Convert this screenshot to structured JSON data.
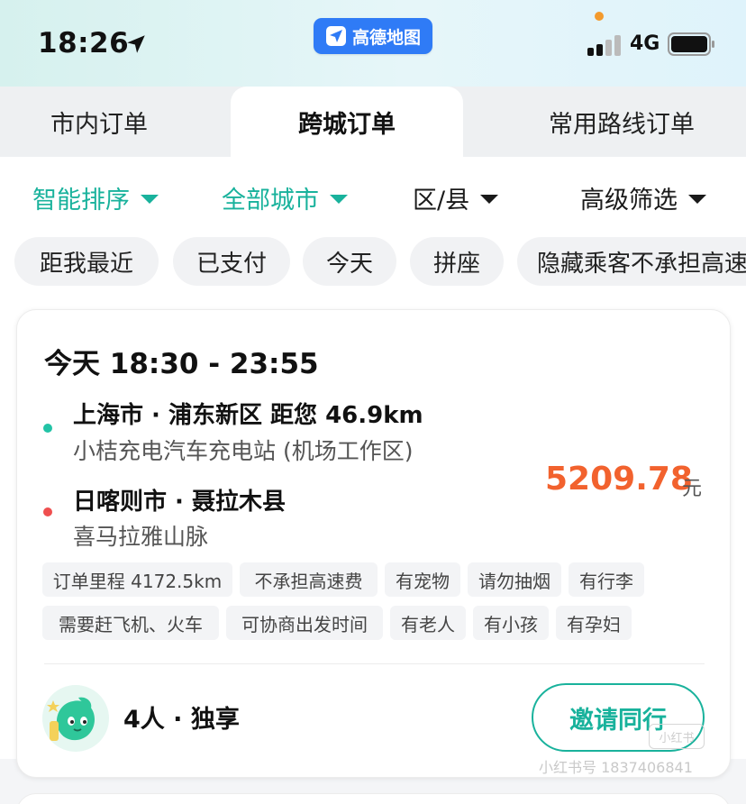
{
  "status_bar": {
    "time": "18:26",
    "app_name": "高德地图",
    "network": "4G"
  },
  "tabs": [
    {
      "label": "市内订单",
      "active": false
    },
    {
      "label": "跨城订单",
      "active": true
    },
    {
      "label": "常用路线订单",
      "active": false
    }
  ],
  "filters": [
    {
      "label": "智能排序",
      "style": "green"
    },
    {
      "label": "全部城市",
      "style": "green"
    },
    {
      "label": "区/县",
      "style": "dark"
    },
    {
      "label": "高级筛选",
      "style": "dark"
    }
  ],
  "chips": [
    "距我最近",
    "已支付",
    "今天",
    "拼座",
    "隐藏乘客不承担高速"
  ],
  "order": {
    "time_range": "今天 18:30 - 23:55",
    "start": {
      "title": "上海市 · 浦东新区 距您 46.9km",
      "detail": "小桔充电汽车充电站 (机场工作区)"
    },
    "end": {
      "title": "日喀则市 · 聂拉木县",
      "detail": "喜马拉雅山脉"
    },
    "price": "5209.78",
    "price_unit": "元",
    "tags_row1": [
      "订单里程 4172.5km",
      "不承担高速费",
      "有宠物",
      "请勿抽烟",
      "有行李"
    ],
    "tags_row2": [
      "需要赶飞机、火车",
      "可协商出发时间",
      "有老人",
      "有小孩",
      "有孕妇"
    ],
    "seats": "4人 · 独享",
    "invite_label": "邀请同行"
  },
  "watermark": {
    "text": "小红书号 1837406841",
    "logo": "小红书"
  },
  "colors": {
    "accent": "#19b29c",
    "price": "#f2622e",
    "start_dot": "#22c3a6",
    "end_dot": "#ef4f4f",
    "brand_blue": "#2f7bf6"
  },
  "icons": [
    "location-arrow-icon",
    "amap-logo-icon",
    "signal-icon",
    "battery-icon",
    "caret-down-icon",
    "passenger-avatar-icon"
  ]
}
